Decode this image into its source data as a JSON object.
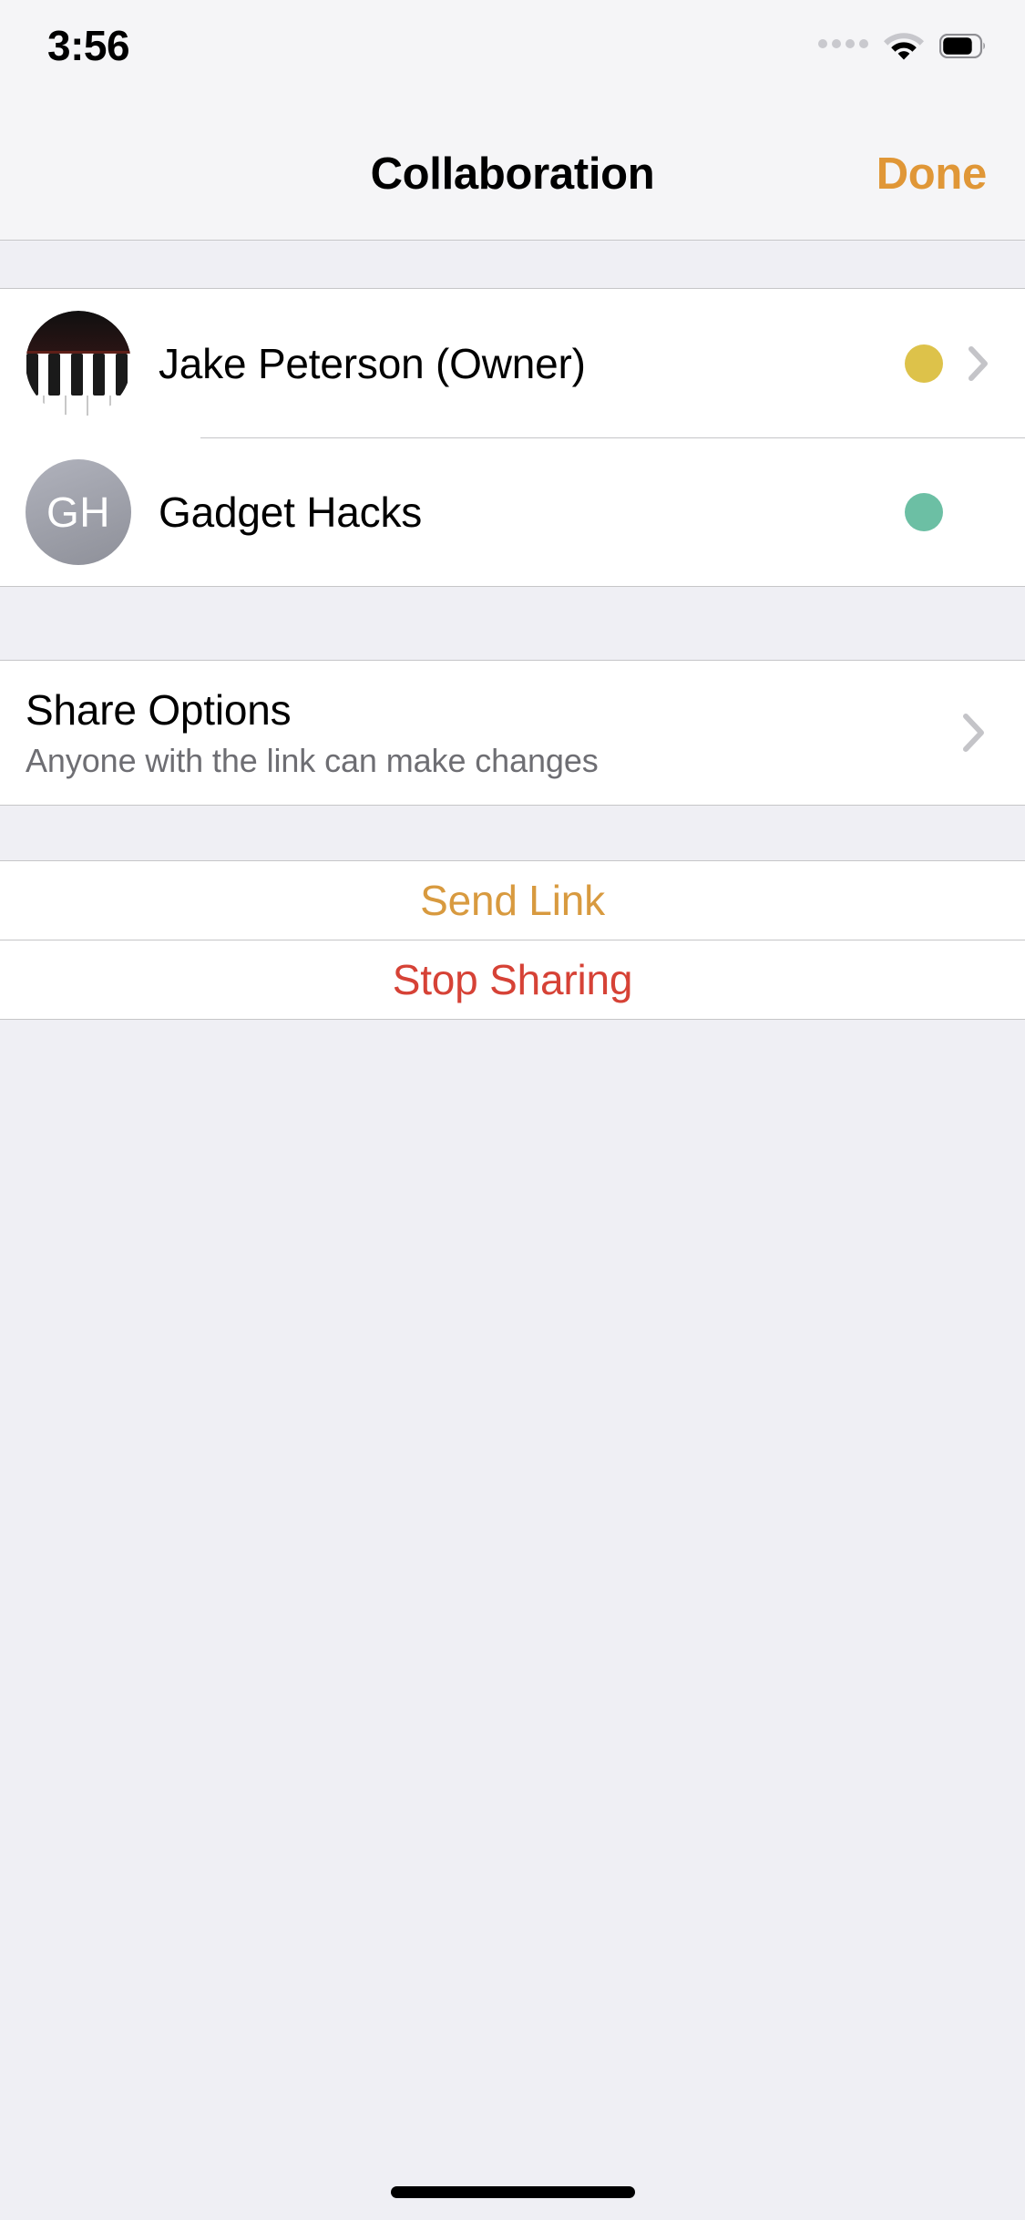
{
  "status_bar": {
    "time": "3:56",
    "cellular_icon": "cellular-signal-icon",
    "wifi_icon": "wifi-icon",
    "battery_icon": "battery-icon",
    "battery_level_percent": 70
  },
  "nav": {
    "title": "Collaboration",
    "done_label": "Done",
    "done_color": "#E09737"
  },
  "participants": [
    {
      "name": "Jake Peterson (Owner)",
      "avatar_type": "piano-keys-photo",
      "status_color": "#DDC24A",
      "has_chevron": true
    },
    {
      "name": "Gadget Hacks",
      "avatar_type": "initials",
      "initials": "GH",
      "status_color": "#6CBFA4",
      "has_chevron": false
    }
  ],
  "share_options": {
    "title": "Share Options",
    "subtitle": "Anyone with the link can make changes",
    "chevron_icon": "chevron-right-icon"
  },
  "actions": [
    {
      "label": "Send Link",
      "color": "#D89A3F",
      "name": "send-link-button"
    },
    {
      "label": "Stop Sharing",
      "color": "#D64236",
      "name": "stop-sharing-button"
    }
  ],
  "home_indicator": "home-indicator"
}
